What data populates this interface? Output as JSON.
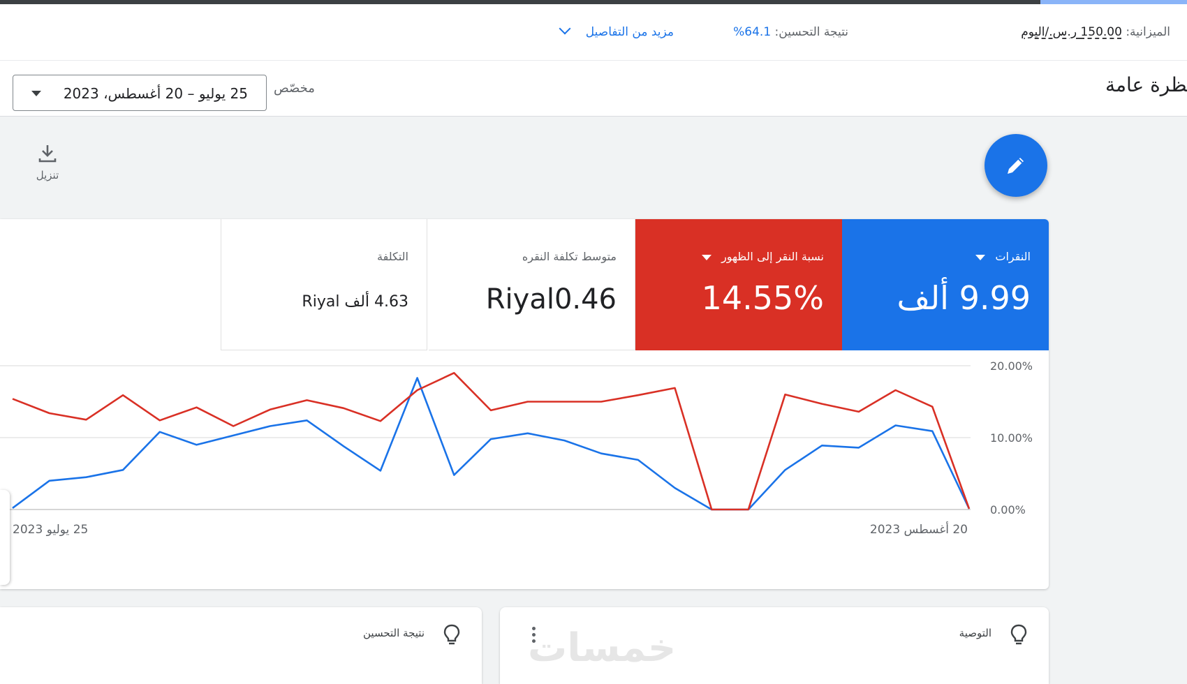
{
  "header": {
    "budget_label": "الميزانية:",
    "budget_value": "150.00 ر.س./اليوم",
    "optimization_label": "نتيجة التحسين:",
    "optimization_value": "64.1%",
    "more_details": "مزيد من التفاصيل",
    "page_title": "نظرة عامة",
    "custom_label": "مخصّص",
    "date_range": "25 يوليو – 20 أغسطس، 2023"
  },
  "toolbar": {
    "download_label": "تنزيل"
  },
  "metrics": [
    {
      "label": "النقرات",
      "value": "9.99 ألف",
      "selected_color": "#1a73e8"
    },
    {
      "label": "نسبة النقر إلى الظهور",
      "value": "14.55%",
      "selected_color": "#d93025"
    },
    {
      "label": "متوسط تكلفة النقره",
      "value": "Riyal0.46"
    },
    {
      "label": "التكلفة",
      "value": "4.63 ألف Riyal"
    }
  ],
  "chart_data": {
    "type": "line",
    "x": [
      "25 يوليو",
      "",
      "",
      "",
      "",
      "",
      "",
      "",
      "",
      "",
      "",
      "",
      "",
      "",
      "",
      "",
      "",
      "",
      "",
      "",
      "",
      "",
      "",
      "",
      "",
      "",
      "20 أغسطس"
    ],
    "x_tick_labels": [
      "25 يوليو 2023",
      "20 أغسطس 2023"
    ],
    "y_ticks": [
      "0.00%",
      "10.00%",
      "20.00%"
    ],
    "ylim": [
      0,
      20
    ],
    "grid": true,
    "series": [
      {
        "name": "النقرات",
        "color": "#1a73e8",
        "values": [
          0.2,
          4.0,
          4.5,
          5.5,
          10.8,
          9.0,
          10.3,
          11.6,
          12.4,
          8.8,
          5.4,
          18.3,
          4.8,
          9.8,
          10.6,
          9.6,
          7.8,
          6.9,
          3.0,
          0.0,
          0.0,
          5.5,
          8.9,
          8.6,
          11.7,
          10.9,
          0.1
        ]
      },
      {
        "name": "نسبة النقر إلى الظهور",
        "color": "#d93025",
        "values": [
          15.4,
          13.4,
          12.5,
          15.9,
          12.4,
          14.2,
          11.6,
          13.9,
          15.2,
          14.1,
          12.3,
          16.6,
          19.0,
          13.8,
          15.0,
          15.0,
          15.0,
          15.9,
          16.9,
          0.0,
          0.0,
          16.0,
          14.7,
          13.6,
          16.6,
          14.3,
          0.1
        ]
      }
    ]
  },
  "cards": {
    "recommendation_title": "التوصية",
    "optimization_title": "نتيجة التحسين",
    "watermark": "خمسات"
  }
}
